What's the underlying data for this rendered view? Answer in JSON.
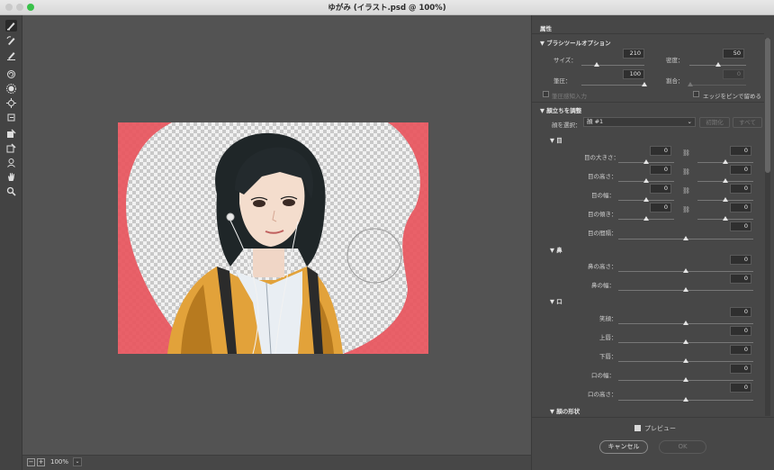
{
  "window": {
    "title": "ゆがみ (イラスト.psd @ 100%)"
  },
  "toolbar": {
    "icons": [
      "forward-warp-icon",
      "reconstruct-icon",
      "smooth-icon",
      "twirl-icon",
      "pucker-icon",
      "bloat-icon",
      "push-left-icon",
      "freeze-mask-icon",
      "thaw-mask-icon",
      "face-tool-icon",
      "hand-icon",
      "zoom-icon"
    ]
  },
  "bottom": {
    "zoom": "100%",
    "minus": "−",
    "plus": "+"
  },
  "panel": {
    "title": "属性",
    "brush": {
      "header": "ブラシツールオプション",
      "size_label": "サイズ：",
      "size_value": "210",
      "density_label": "密度：",
      "density_value": "50",
      "pressure_label": "筆圧：",
      "pressure_value": "100",
      "rate_label": "割合：",
      "rate_value": "0",
      "stylus_label": "筆圧感知入力",
      "pin_edges_label": "エッジをピンで留める"
    },
    "face": {
      "header": "顔立ちを調整",
      "select_label": "顔を選択：",
      "select_value": "顔 #1",
      "reset_label": "初期化",
      "all_label": "すべて",
      "eyes": {
        "header": "目",
        "size_label": "目の大きさ：",
        "size_left": "0",
        "size_right": "0",
        "height_label": "目の高さ：",
        "height_left": "0",
        "height_right": "0",
        "width_label": "目の幅：",
        "width_left": "0",
        "width_right": "0",
        "tilt_label": "目の傾き：",
        "tilt_left": "0",
        "tilt_right": "0",
        "distance_label": "目の間隔：",
        "distance_value": "0"
      },
      "nose": {
        "header": "鼻",
        "height_label": "鼻の高さ：",
        "height_value": "0",
        "width_label": "鼻の幅：",
        "width_value": "0"
      },
      "mouth": {
        "header": "口",
        "smile_label": "笑顔：",
        "smile_value": "0",
        "upper_label": "上唇：",
        "upper_value": "0",
        "lower_label": "下唇：",
        "lower_value": "0",
        "width_label": "口の幅：",
        "width_value": "0",
        "height_label": "口の高さ：",
        "height_value": "0"
      },
      "shape_header": "顔の形状"
    },
    "preview_label": "プレビュー",
    "cancel_label": "キャンセル",
    "ok_label": "OK"
  },
  "colors": {
    "mask": "#e8555d",
    "accent_green": "#39c14a",
    "panel_bg": "#474747"
  }
}
